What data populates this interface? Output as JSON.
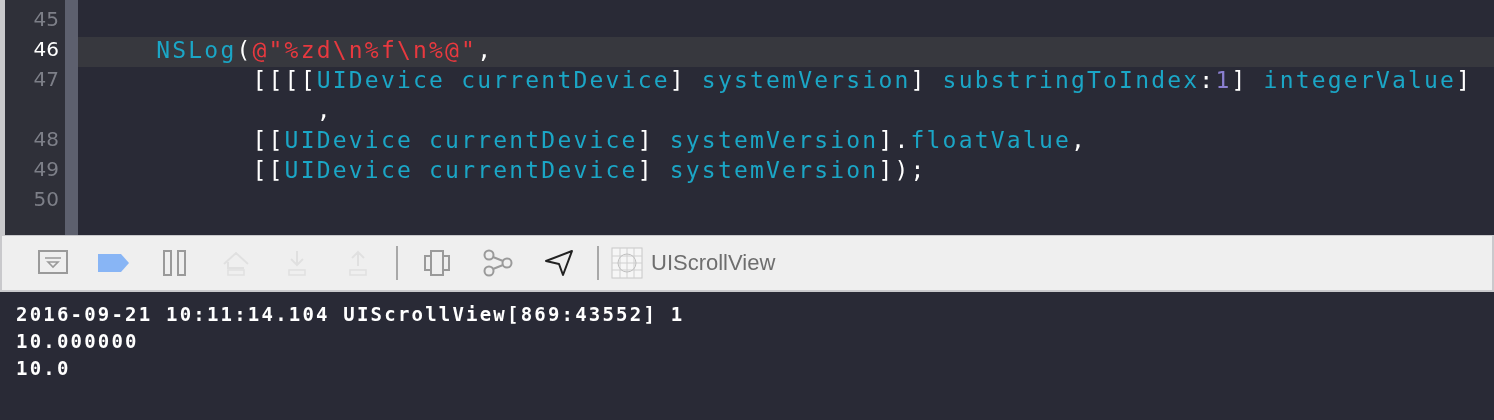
{
  "editor": {
    "lines": [
      {
        "number": "45",
        "current": false
      },
      {
        "number": "46",
        "current": true,
        "kind": "statement",
        "segments": [
          {
            "kind": "ident",
            "text": "NSLog"
          },
          {
            "kind": "plain",
            "text": "("
          },
          {
            "kind": "string",
            "text": "@\"%zd\\n%f\\n%@\""
          },
          {
            "kind": "plain",
            "text": ","
          }
        ]
      },
      {
        "number": "47",
        "current": false,
        "kind": "argument",
        "segments": [
          {
            "kind": "plain",
            "text": "[[[["
          },
          {
            "kind": "ident",
            "text": "UIDevice currentDevice"
          },
          {
            "kind": "plain",
            "text": "] "
          },
          {
            "kind": "ident",
            "text": "systemVersion"
          },
          {
            "kind": "plain",
            "text": "] "
          },
          {
            "kind": "ident",
            "text": "substringToIndex"
          },
          {
            "kind": "plain",
            "text": ":"
          },
          {
            "kind": "number",
            "text": "1"
          },
          {
            "kind": "plain",
            "text": "] "
          },
          {
            "kind": "ident",
            "text": "integerValue"
          },
          {
            "kind": "plain",
            "text": "]"
          }
        ]
      },
      {
        "current": false,
        "kind": "wrap",
        "segments": [
          {
            "kind": "plain",
            "text": ","
          }
        ]
      },
      {
        "number": "48",
        "current": false,
        "kind": "argument",
        "segments": [
          {
            "kind": "plain",
            "text": "[["
          },
          {
            "kind": "ident",
            "text": "UIDevice currentDevice"
          },
          {
            "kind": "plain",
            "text": "] "
          },
          {
            "kind": "ident",
            "text": "systemVersion"
          },
          {
            "kind": "plain",
            "text": "]."
          },
          {
            "kind": "ident",
            "text": "floatValue"
          },
          {
            "kind": "plain",
            "text": ","
          }
        ]
      },
      {
        "number": "49",
        "current": false,
        "kind": "argument",
        "segments": [
          {
            "kind": "plain",
            "text": "[["
          },
          {
            "kind": "ident",
            "text": "UIDevice currentDevice"
          },
          {
            "kind": "plain",
            "text": "] "
          },
          {
            "kind": "ident",
            "text": "systemVersion"
          },
          {
            "kind": "plain",
            "text": "]);"
          }
        ]
      },
      {
        "number": "50",
        "current": false
      }
    ]
  },
  "debug_bar": {
    "groups": [
      [
        {
          "kind": "hide",
          "disabled": false
        },
        {
          "kind": "breakpoints",
          "disabled": false
        },
        {
          "kind": "pause",
          "disabled": false
        },
        {
          "kind": "step-over",
          "disabled": true
        },
        {
          "kind": "step-into",
          "disabled": true
        },
        {
          "kind": "step-out",
          "disabled": true
        }
      ],
      [
        {
          "kind": "view-debug",
          "disabled": false
        },
        {
          "kind": "memory-graph",
          "disabled": false
        },
        {
          "kind": "location",
          "disabled": false
        }
      ]
    ],
    "target": "UIScrollView"
  },
  "console": {
    "lines": [
      "2016-09-21 10:11:14.104 UIScrollView[869:43552] 1",
      "10.000000",
      "10.0"
    ]
  }
}
